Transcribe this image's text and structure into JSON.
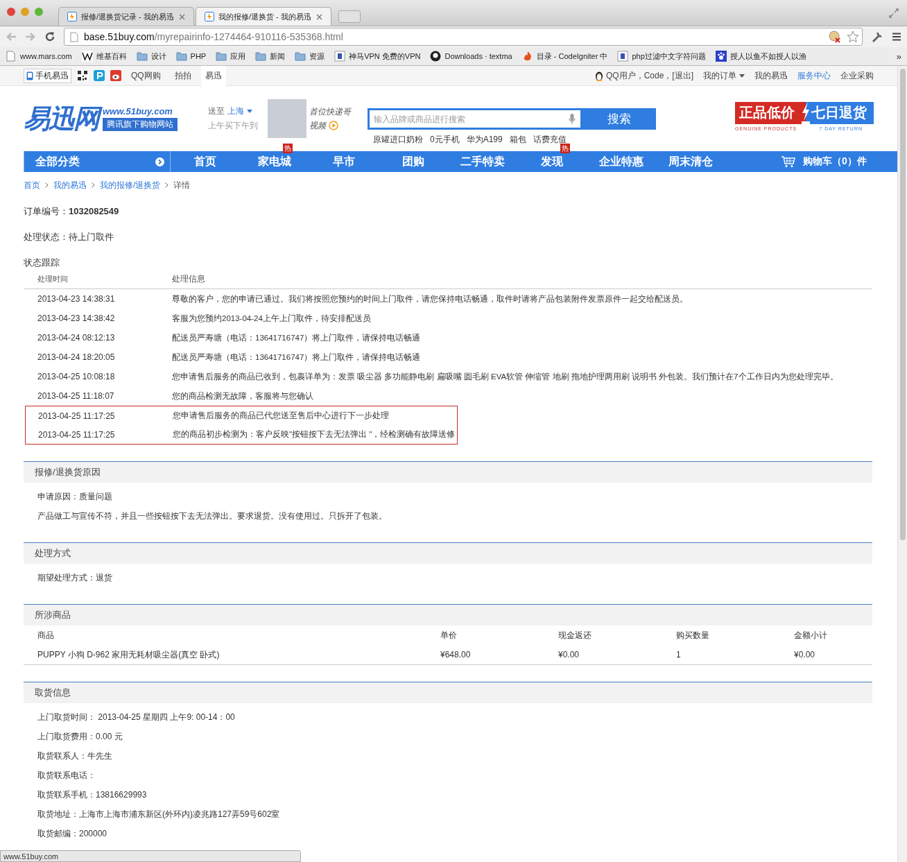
{
  "browser": {
    "tabs": [
      {
        "title": "报修/退换货记录 - 我的易迅",
        "selected": false
      },
      {
        "title": "我的报修/退换货 - 我的易迅",
        "selected": true
      }
    ],
    "address": {
      "host": "base.51buy.com",
      "path": "/myrepairinfo-1274464-910116-535368.html"
    },
    "bookmarks": [
      {
        "label": "www.mars.com",
        "kind": "page"
      },
      {
        "label": "维基百科",
        "kind": "wiki"
      },
      {
        "label": "设计",
        "kind": "folder"
      },
      {
        "label": "PHP",
        "kind": "folder"
      },
      {
        "label": "应用",
        "kind": "folder"
      },
      {
        "label": "新闻",
        "kind": "folder"
      },
      {
        "label": "资源",
        "kind": "folder"
      },
      {
        "label": "神马VPN 免费的VPN",
        "kind": "site"
      },
      {
        "label": "Downloads · textma",
        "kind": "github"
      },
      {
        "label": "目录 - CodeIgniter 中",
        "kind": "flame"
      },
      {
        "label": "php过滤中文字符问题",
        "kind": "site"
      },
      {
        "label": "授人以鱼不如授人以渔",
        "kind": "paw"
      }
    ],
    "bookmarks_more": "»"
  },
  "topbar": {
    "left": [
      {
        "label": "手机易迅",
        "kind": "mobile"
      },
      {
        "label": "QQ网购",
        "kind": "link",
        "selected": false
      },
      {
        "label": "拍拍",
        "kind": "link",
        "selected": false
      },
      {
        "label": "易迅",
        "kind": "link",
        "selected": true
      }
    ],
    "user": "QQ用户，Code，[退出]",
    "right": [
      {
        "label": "我的订单",
        "dropdown": true,
        "accent": false
      },
      {
        "label": "我的易迅",
        "dropdown": false,
        "accent": false
      },
      {
        "label": "服务中心",
        "dropdown": false,
        "accent": true
      },
      {
        "label": "企业采购",
        "dropdown": false,
        "accent": false
      }
    ]
  },
  "header": {
    "logo": "易迅网",
    "site_url": "www.51buy.com",
    "slogan": "腾讯旗下购物网站",
    "deliver": {
      "label": "送至",
      "city": "上海",
      "note": "上午买下午到"
    },
    "promo": {
      "line1": "首位快递哥",
      "line2": "视频"
    },
    "search": {
      "placeholder": "输入品牌或商品进行搜索",
      "button": "搜索"
    },
    "hot_keywords": [
      "原罐进口奶粉",
      "0元手机",
      "华为A199",
      "箱包",
      "话费充值"
    ],
    "banner": {
      "left": "正品低价",
      "right": "七日退货",
      "left_en": "GENUINE PRODUCTS",
      "right_en": "7 DAY RETURN"
    }
  },
  "nav": {
    "all": "全部分类",
    "items": [
      {
        "label": "首页"
      },
      {
        "label": "家电城",
        "badge": "热"
      },
      {
        "label": "早市"
      },
      {
        "label": "团购"
      },
      {
        "label": "二手特卖"
      },
      {
        "label": "发现",
        "badge": "热"
      },
      {
        "label": "企业特惠"
      },
      {
        "label": "周末清仓"
      }
    ],
    "cart": "购物车（0）件"
  },
  "breadcrumb": [
    "首页",
    "我的易迅",
    "我的报修/退换货",
    "详情"
  ],
  "order": {
    "label": "订单编号：",
    "value": "1032082549"
  },
  "status": {
    "label": "处理状态：",
    "value": "待上门取件"
  },
  "tracking": {
    "title": "状态跟踪",
    "columns": [
      "处理时间",
      "处理信息"
    ],
    "rows": [
      {
        "time": "2013-04-23 14:38:31",
        "info": "尊敬的客户，您的申请已通过。我们将按照您预约的时间上门取件，请您保持电话畅通，取件时请将产品包装附件发票原件一起交给配送员。",
        "highlighted": false
      },
      {
        "time": "2013-04-23 14:38:42",
        "info": "客服为您预约2013-04-24上午上门取件，待安排配送员",
        "highlighted": false
      },
      {
        "time": "2013-04-24 08:12:13",
        "info": "配送员严寿塘（电话：13641716747）将上门取件，请保持电话畅通",
        "highlighted": false
      },
      {
        "time": "2013-04-24 18:20:05",
        "info": "配送员严寿塘（电话：13641716747）将上门取件，请保持电话畅通",
        "highlighted": false
      },
      {
        "time": "2013-04-25 10:08:18",
        "info": "您申请售后服务的商品已收到，包裹详单为：发票 吸尘器 多功能静电刷 扁吸嘴 圆毛刷 EVA软管 伸缩管 地刷 拖地护理两用刷 说明书 外包装。我们预计在7个工作日内为您处理完毕。",
        "highlighted": false
      },
      {
        "time": "2013-04-25 11:18:07",
        "info": "您的商品检测无故障，客服将与您确认",
        "highlighted": false
      },
      {
        "time": "2013-04-25 11:17:25",
        "info": "您申请售后服务的商品已代您送至售后中心进行下一步处理",
        "highlighted": true
      },
      {
        "time": "2013-04-25 11:17:25",
        "info": "您的商品初步检测为：客户反映\"按钮按下去无法弹出 \"，经检测确有故障送修",
        "highlighted": true
      }
    ]
  },
  "reason": {
    "title": "报修/退换货原因",
    "lines": [
      "申请原因：质量问题",
      "产品做工与宣传不符，并且一些按钮按下去无法弹出。要求退货。没有使用过。只拆开了包装。"
    ]
  },
  "method": {
    "title": "处理方式",
    "lines": [
      "期望处理方式：退货"
    ]
  },
  "products": {
    "title": "所涉商品",
    "columns": [
      "商品",
      "单价",
      "现金返还",
      "购买数量",
      "金额小计"
    ],
    "rows": [
      [
        "PUPPY 小狗 D-962 家用无耗材吸尘器(真空 卧式)",
        "¥648.00",
        "¥0.00",
        "1",
        "¥0.00"
      ]
    ]
  },
  "pickup": {
    "title": "取货信息",
    "lines": [
      "上门取货时间： 2013-04-25 星期四 上午9: 00-14：00",
      "上门取货费用：0.00 元",
      "取货联系人：牛先生",
      "取货联系电话：",
      "取货联系手机：13816629993",
      "取货地址：上海市上海市浦东新区(外环内)凌兆路127弄59号602室",
      "取货邮编：200000"
    ]
  },
  "status_bar": "www.51buy.com"
}
